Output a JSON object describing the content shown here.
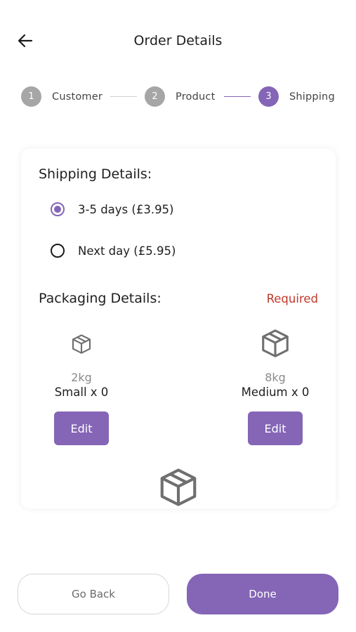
{
  "header": {
    "title": "Order Details",
    "back_icon": "arrow-left-icon"
  },
  "stepper": {
    "steps": [
      {
        "number": "1",
        "label": "Customer",
        "state": "completed"
      },
      {
        "number": "2",
        "label": "Product",
        "state": "completed"
      },
      {
        "number": "3",
        "label": "Shipping",
        "state": "active"
      }
    ]
  },
  "shipping": {
    "title": "Shipping Details:",
    "options": [
      {
        "label": "3-5 days (£3.95)",
        "selected": true
      },
      {
        "label": "Next day (£5.95)",
        "selected": false
      }
    ]
  },
  "packaging": {
    "title": "Packaging Details:",
    "required_label": "Required",
    "items": [
      {
        "weight": "2kg",
        "name": "Small x 0",
        "edit_label": "Edit",
        "icon": "box-icon"
      },
      {
        "weight": "8kg",
        "name": "Medium x 0",
        "edit_label": "Edit",
        "icon": "box-icon"
      }
    ],
    "third_item_icon": "box-icon"
  },
  "footer": {
    "go_back_label": "Go Back",
    "done_label": "Done"
  },
  "colors": {
    "accent": "#8465b6",
    "inactive_step": "#a6a6a6",
    "required": "#c0392b",
    "muted_text": "#8a8a8a"
  }
}
